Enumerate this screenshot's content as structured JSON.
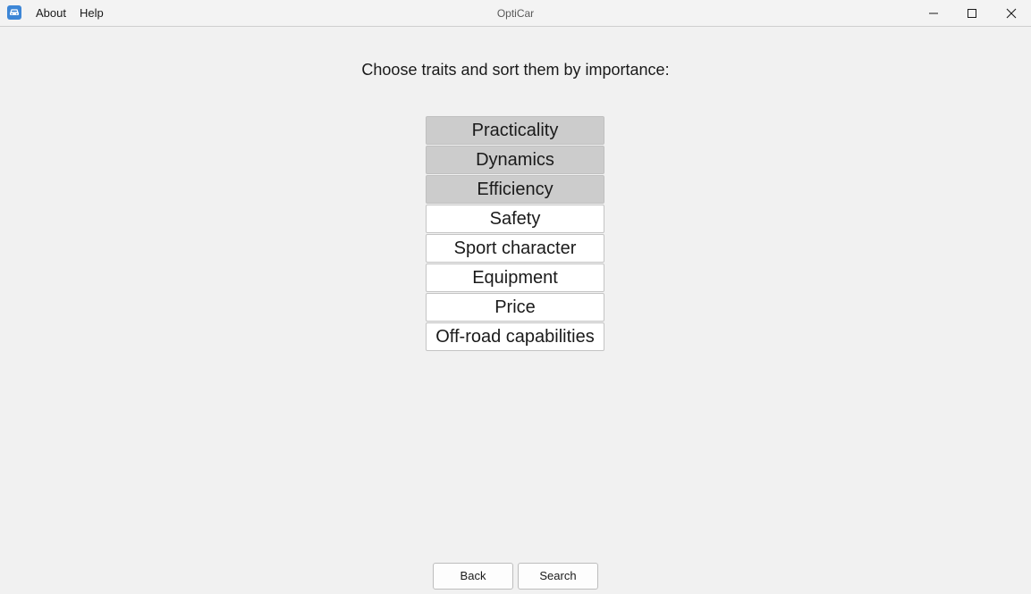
{
  "window": {
    "title": "OptiCar",
    "menu": {
      "about": "About",
      "help": "Help"
    }
  },
  "main": {
    "prompt": "Choose traits and sort them by importance:",
    "traits": [
      {
        "label": "Practicality",
        "selected": true
      },
      {
        "label": "Dynamics",
        "selected": true
      },
      {
        "label": "Efficiency",
        "selected": true
      },
      {
        "label": "Safety",
        "selected": false
      },
      {
        "label": "Sport character",
        "selected": false
      },
      {
        "label": "Equipment",
        "selected": false
      },
      {
        "label": "Price",
        "selected": false
      },
      {
        "label": "Off-road capabilities",
        "selected": false
      }
    ]
  },
  "footer": {
    "back_label": "Back",
    "search_label": "Search"
  },
  "colors": {
    "selected_bg": "#cccccc",
    "unselected_bg": "#ffffff",
    "app_icon": "#3d86d6"
  },
  "icons": {
    "app": "car-icon",
    "minimize": "minimize-icon",
    "maximize": "maximize-icon",
    "close": "close-icon"
  }
}
